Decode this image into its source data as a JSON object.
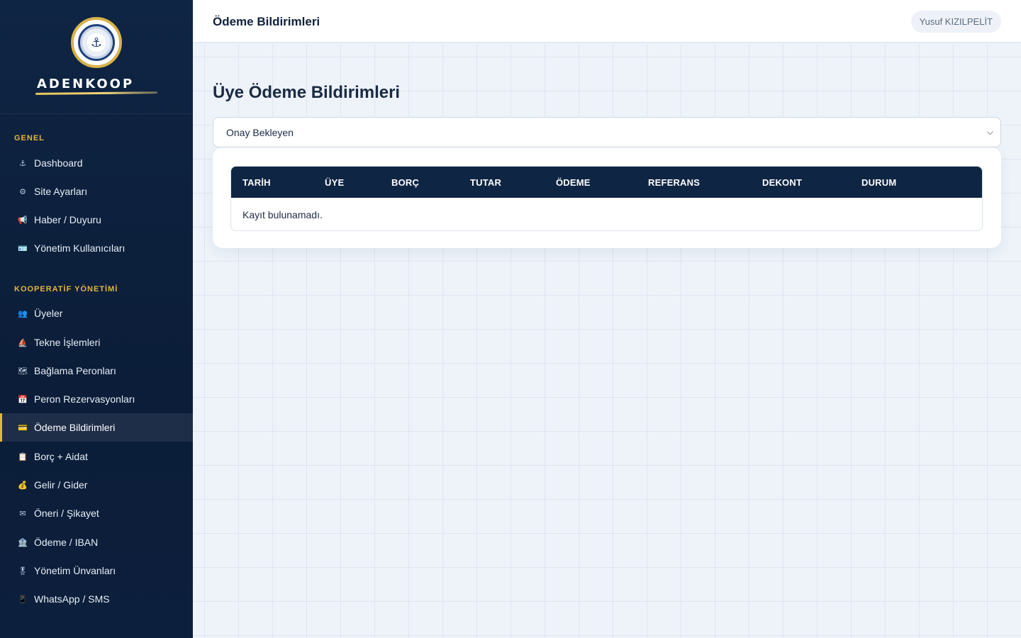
{
  "brand": {
    "name": "ADENKOOP"
  },
  "sidebar": {
    "sections": [
      {
        "title": "GENEL"
      },
      {
        "title": "KOOPERATİF YÖNETİMİ"
      }
    ],
    "items": [
      {
        "label": "Dashboard",
        "icon": "anchor-icon",
        "glyph": "⚓"
      },
      {
        "label": "Site Ayarları",
        "icon": "gear-icon",
        "glyph": "⚙"
      },
      {
        "label": "Haber / Duyuru",
        "icon": "megaphone-icon",
        "glyph": "📢"
      },
      {
        "label": "Yönetim Kullanıcıları",
        "icon": "id-card-icon",
        "glyph": "🪪"
      },
      {
        "label": "Üyeler",
        "icon": "users-icon",
        "glyph": "👥"
      },
      {
        "label": "Tekne İşlemleri",
        "icon": "sailboat-icon",
        "glyph": "⛵"
      },
      {
        "label": "Bağlama Peronları",
        "icon": "map-icon",
        "glyph": "🗺"
      },
      {
        "label": "Peron Rezervasyonları",
        "icon": "calendar-icon",
        "glyph": "📅"
      },
      {
        "label": "Ödeme Bildirimleri",
        "icon": "credit-card-icon",
        "glyph": "💳"
      },
      {
        "label": "Borç + Aidat",
        "icon": "clipboard-icon",
        "glyph": "📋"
      },
      {
        "label": "Gelir / Gider",
        "icon": "money-bag-icon",
        "glyph": "💰"
      },
      {
        "label": "Öneri / Şikayet",
        "icon": "envelope-icon",
        "glyph": "✉"
      },
      {
        "label": "Ödeme / IBAN",
        "icon": "bank-icon",
        "glyph": "🏦"
      },
      {
        "label": "Yönetim Ünvanları",
        "icon": "medal-icon",
        "glyph": "🎖"
      },
      {
        "label": "WhatsApp / SMS",
        "icon": "phone-icon",
        "glyph": "📱"
      }
    ]
  },
  "topbar": {
    "title": "Ödeme Bildirimleri",
    "user": "Yusuf KIZILPELİT"
  },
  "main": {
    "page_title": "Üye Ödeme Bildirimleri",
    "filter": {
      "selected": "Onay Bekleyen"
    },
    "table": {
      "columns": [
        "TARİH",
        "ÜYE",
        "BORÇ",
        "TUTAR",
        "ÖDEME",
        "REFERANS",
        "DEKONT",
        "DURUM"
      ],
      "empty_message": "Kayıt bulunamadı."
    }
  },
  "colors": {
    "sidebar_bg": "#0f2544",
    "accent": "#e3b53c",
    "table_header": "#0f2544"
  }
}
